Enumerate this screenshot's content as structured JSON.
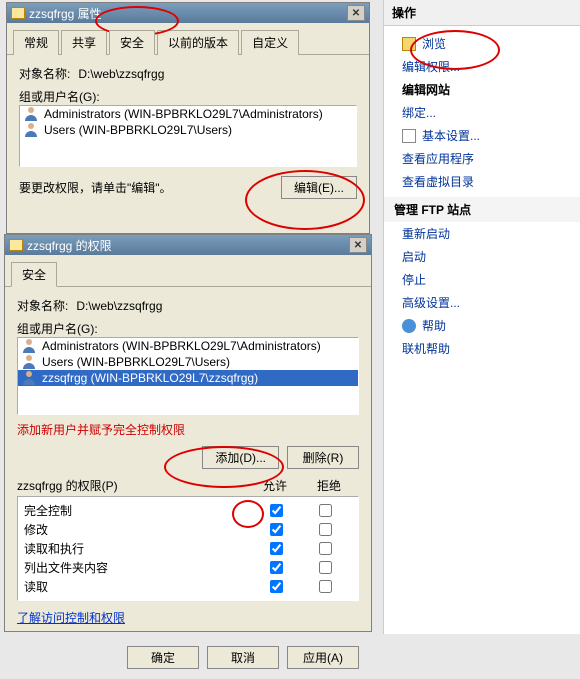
{
  "dlg1": {
    "title": "zzsqfrgg 属性",
    "tabs": [
      "常规",
      "共享",
      "安全",
      "以前的版本",
      "自定义"
    ],
    "active_tab": 2,
    "object_label": "对象名称:",
    "object_path": "D:\\web\\zzsqfrgg",
    "group_label": "组或用户名(G):",
    "users": [
      "Administrators (WIN-BPBRKLO29L7\\Administrators)",
      "Users (WIN-BPBRKLO29L7\\Users)"
    ],
    "edit_note": "要更改权限，请单击\"编辑\"。",
    "edit_btn": "编辑(E)..."
  },
  "dlg2": {
    "title": "zzsqfrgg 的权限",
    "tab": "安全",
    "object_label": "对象名称:",
    "object_path": "D:\\web\\zzsqfrgg",
    "group_label": "组或用户名(G):",
    "users": [
      {
        "text": "Administrators (WIN-BPBRKLO29L7\\Administrators)",
        "sel": false
      },
      {
        "text": "Users (WIN-BPBRKLO29L7\\Users)",
        "sel": false
      },
      {
        "text": "zzsqfrgg (WIN-BPBRKLO29L7\\zzsqfrgg)",
        "sel": true
      }
    ],
    "red_note": "添加新用户并赋予完全控制权限",
    "add_btn": "添加(D)...",
    "remove_btn": "删除(R)",
    "perm_label": "zzsqfrgg 的权限(P)",
    "allow_col": "允许",
    "deny_col": "拒绝",
    "perms": [
      {
        "name": "完全控制",
        "allow": true,
        "deny": false
      },
      {
        "name": "修改",
        "allow": true,
        "deny": false
      },
      {
        "name": "读取和执行",
        "allow": true,
        "deny": false
      },
      {
        "name": "列出文件夹内容",
        "allow": true,
        "deny": false
      },
      {
        "name": "读取",
        "allow": true,
        "deny": false
      }
    ],
    "learn_link": "了解访问控制和权限",
    "ok": "确定",
    "cancel": "取消",
    "apply": "应用(A)"
  },
  "panel": {
    "title": "操作",
    "items": [
      {
        "type": "link",
        "text": "浏览",
        "icon": "browse"
      },
      {
        "type": "link",
        "text": "编辑权限..."
      },
      {
        "type": "bold",
        "text": "编辑网站"
      },
      {
        "type": "link",
        "text": "绑定..."
      },
      {
        "type": "link",
        "text": "基本设置...",
        "icon": "doc"
      },
      {
        "type": "link",
        "text": "查看应用程序"
      },
      {
        "type": "link",
        "text": "查看虚拟目录"
      },
      {
        "type": "section",
        "text": "管理 FTP 站点"
      },
      {
        "type": "link",
        "text": "重新启动"
      },
      {
        "type": "link",
        "text": "启动"
      },
      {
        "type": "link",
        "text": "停止"
      },
      {
        "type": "link",
        "text": "高级设置..."
      },
      {
        "type": "link",
        "text": "帮助",
        "icon": "help"
      },
      {
        "type": "link",
        "text": "联机帮助"
      }
    ]
  }
}
